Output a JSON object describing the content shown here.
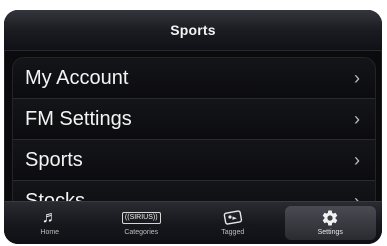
{
  "header": {
    "title": "Sports"
  },
  "menu": {
    "items": [
      {
        "label": "My Account",
        "chevron": "›"
      },
      {
        "label": "FM Settings",
        "chevron": "›"
      },
      {
        "label": "Sports",
        "chevron": "›"
      },
      {
        "label": "Stocks",
        "chevron": "›"
      }
    ]
  },
  "tabbar": {
    "tabs": [
      {
        "label": "Home",
        "icon": "music-note-icon"
      },
      {
        "label": "Categories",
        "icon": "radio-logo-icon",
        "icon_text": "((SIRIUS))"
      },
      {
        "label": "Tagged",
        "icon": "tag-icon"
      },
      {
        "label": "Settings",
        "icon": "gear-icon",
        "active": true
      }
    ]
  },
  "colors": {
    "background": "#0b0b0e",
    "text": "#f4f4f4",
    "accent": "#4a4b52"
  }
}
